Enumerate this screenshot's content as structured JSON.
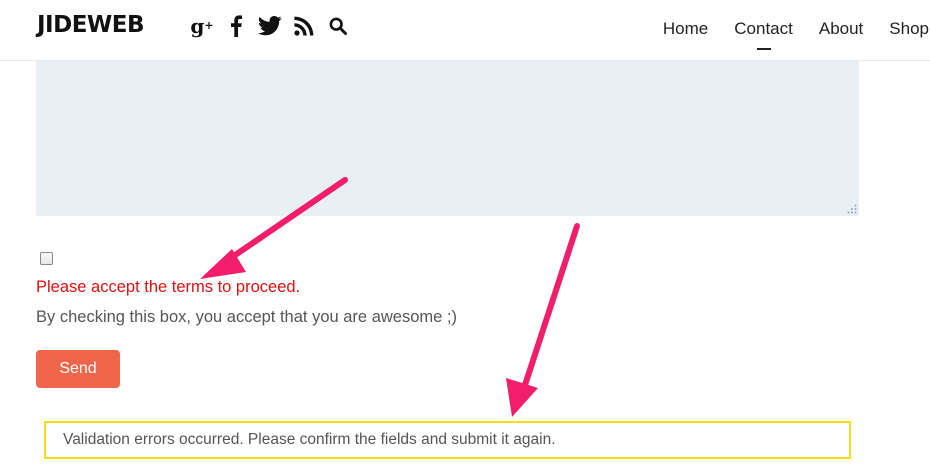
{
  "header": {
    "logo": "JIDEWEB",
    "social_icons": [
      "google-plus-icon",
      "facebook-icon",
      "twitter-icon",
      "rss-icon",
      "search-icon"
    ],
    "nav": [
      {
        "label": "Home",
        "active": false
      },
      {
        "label": "Contact",
        "active": true
      },
      {
        "label": "About",
        "active": false
      },
      {
        "label": "Shop",
        "active": false
      }
    ]
  },
  "form": {
    "message_value": "",
    "terms_checked": false,
    "terms_error": "Please accept the terms to proceed.",
    "terms_label": "By checking this box, you accept that you are awesome ;)",
    "send_label": "Send",
    "validation_message": "Validation errors occurred. Please confirm the fields and submit it again."
  },
  "colors": {
    "accent": "#f0664b",
    "error": "#e01010",
    "validation_border": "#f5dd19",
    "textarea_bg": "#e8f0f6",
    "annotation_arrow": "#f21d6b"
  }
}
